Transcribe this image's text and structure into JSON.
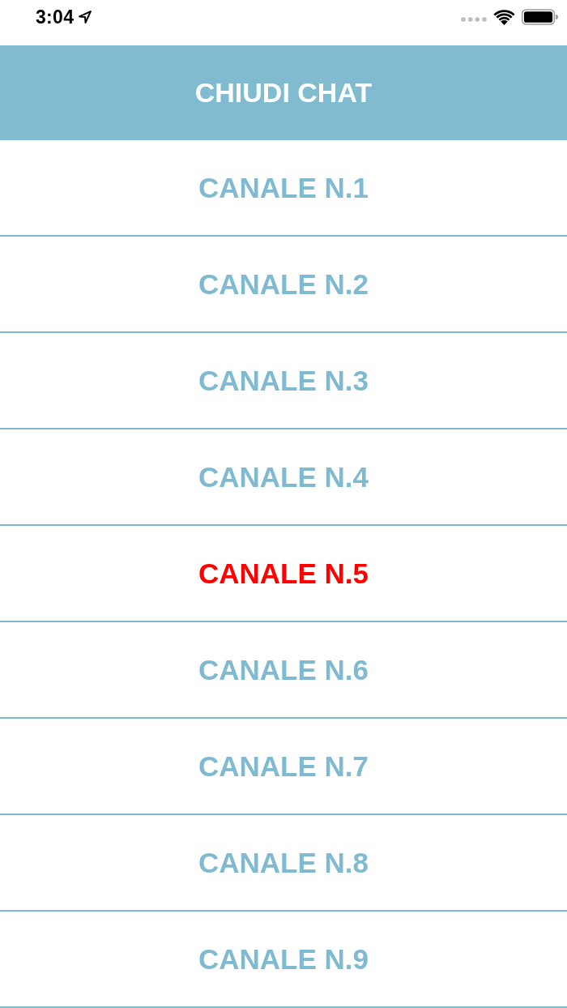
{
  "status_bar": {
    "time": "3:04"
  },
  "header": {
    "title": "CHIUDI CHAT"
  },
  "channels": [
    {
      "label": "CANALE N.1",
      "selected": false
    },
    {
      "label": "CANALE N.2",
      "selected": false
    },
    {
      "label": "CANALE N.3",
      "selected": false
    },
    {
      "label": "CANALE N.4",
      "selected": false
    },
    {
      "label": "CANALE N.5",
      "selected": true
    },
    {
      "label": "CANALE N.6",
      "selected": false
    },
    {
      "label": "CANALE N.7",
      "selected": false
    },
    {
      "label": "CANALE N.8",
      "selected": false
    },
    {
      "label": "CANALE N.9",
      "selected": false
    }
  ]
}
